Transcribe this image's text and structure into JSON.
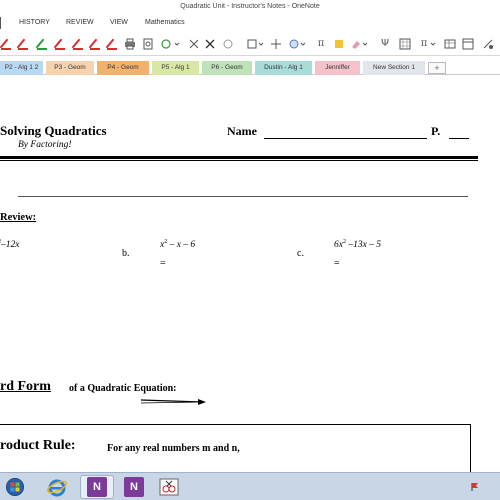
{
  "window": {
    "title": "Quadratic Unit - Instructor's Notes - OneNote"
  },
  "ribbon": {
    "tabs": [
      {
        "label": "HISTORY"
      },
      {
        "label": "REVIEW"
      },
      {
        "label": "VIEW"
      },
      {
        "label": "Mathematics"
      }
    ]
  },
  "toolbar": {
    "pen_colors": [
      "#d62e2e",
      "#d62e2e",
      "#2a9c3a",
      "#d62e2e",
      "#d62e2e",
      "#d62e2e",
      "#d62e2e"
    ],
    "icons": [
      "printer-icon",
      "print-preview-icon",
      "shapes-icon",
      "delete-icon",
      "lasso-icon",
      "frame-icon",
      "dropdown-icon",
      "pan-icon",
      "pi-symbol-icon",
      "highlighter-icon",
      "eraser-icon",
      "fork-symbol-icon",
      "grid-icon",
      "pi-menu-icon",
      "table-icon",
      "layout-icon",
      "more-icon"
    ],
    "pi_glyph": "π",
    "fork_glyph": "Ψ"
  },
  "sections": {
    "tabs": [
      {
        "label": "P2 - Alg 1 2",
        "color": "#b9d9f2"
      },
      {
        "label": "P3 - Geom",
        "color": "#f6d2ae"
      },
      {
        "label": "P4 - Geom",
        "color": "#f3b26b"
      },
      {
        "label": "P5 - Alg 1",
        "color": "#d9e7a6"
      },
      {
        "label": "P6 - Geom",
        "color": "#bfe3b9"
      },
      {
        "label": "Dustin - Alg 1",
        "color": "#a9dcd6"
      },
      {
        "label": "Jenniffer",
        "color": "#f5c2cb"
      },
      {
        "label": "New Section 1",
        "color": "#e2e5ea"
      }
    ],
    "add_label": "+"
  },
  "page": {
    "title": "Solving Quadratics",
    "subtitle": "By Factoring!",
    "name_label": "Name",
    "period_label": "P.",
    "review_label": "Review:",
    "problem_a": {
      "expr_rest": "–12x",
      "expr_sup": "2"
    },
    "problem_b": {
      "label": "b.",
      "expr_base": "x",
      "expr_sup": "2",
      "expr_rest": " – x – 6",
      "equals": "="
    },
    "problem_c": {
      "label": "c.",
      "expr_base": "6x",
      "expr_sup": "2",
      "expr_rest": " –13x – 5",
      "equals": "="
    },
    "standard_form_label": "rd Form",
    "standard_form_suffix": "of a Quadratic Equation:",
    "product_rule_label": "roduct Rule:",
    "product_rule_text": "For any real numbers m and n,"
  },
  "taskbar": {
    "onenote_glyph": "N",
    "onenote2_glyph": "N"
  }
}
